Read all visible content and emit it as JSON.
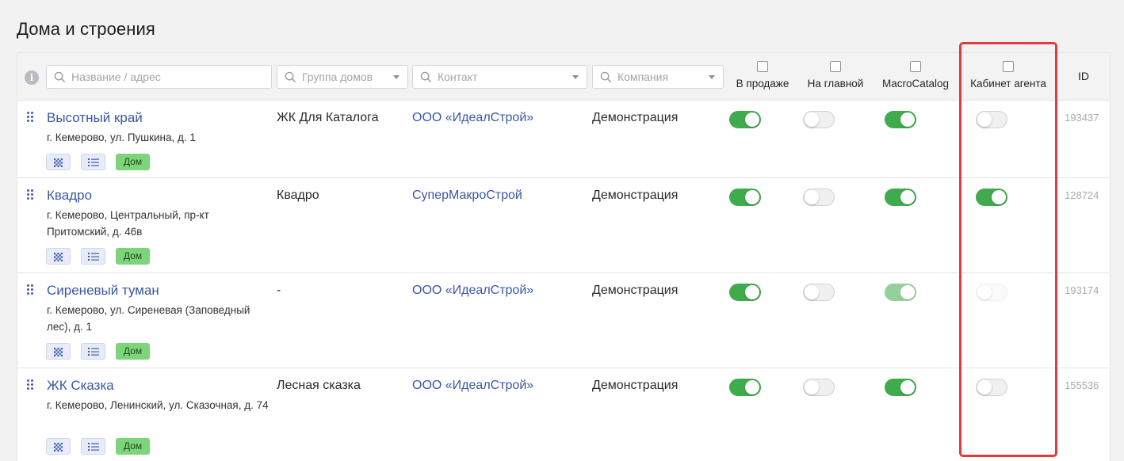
{
  "page": {
    "title": "Дома и строения"
  },
  "filters": {
    "name_placeholder": "Название / адрес",
    "group_placeholder": "Группа домов",
    "contact_placeholder": "Контакт",
    "company_placeholder": "Компания"
  },
  "columns": {
    "on_sale": "В продаже",
    "on_main": "На главной",
    "macro_catalog": "MacroCatalog",
    "agent_cabinet": "Кабинет агента",
    "id": "ID"
  },
  "tag_label": "Дом",
  "colors": {
    "accent": "#3a57a6",
    "toggle_on": "#3fab4c",
    "tag": "#7dd47a",
    "highlight": "#e23b3b"
  },
  "rows": [
    {
      "name": "Высотный край",
      "address": "г. Кемерово, ул. Пушкина, д. 1",
      "group": "ЖК Для Каталога",
      "contact": "ООО «ИдеалСтрой»",
      "company": "Демонстрация",
      "on_sale": true,
      "on_main": false,
      "macro_catalog": true,
      "agent_cabinet": false,
      "id": "193437"
    },
    {
      "name": "Квадро",
      "address": "г. Кемерово, Центральный, пр-кт Притомский, д. 46в",
      "group": "Квадро",
      "contact": "СуперМакроСтрой",
      "company": "Демонстрация",
      "on_sale": true,
      "on_main": false,
      "macro_catalog": true,
      "agent_cabinet": true,
      "id": "128724"
    },
    {
      "name": "Сиреневый туман",
      "address": "г. Кемерово, ул. Сиреневая (Заповедный лес), д. 1",
      "group": "-",
      "contact": "ООО «ИдеалСтрой»",
      "company": "Демонстрация",
      "on_sale": true,
      "on_main": false,
      "macro_catalog": true,
      "agent_cabinet": false,
      "macro_catalog_disabled": true,
      "agent_cabinet_disabled": true,
      "id": "193174"
    },
    {
      "name": "ЖК Сказка",
      "address": "г. Кемерово, Ленинский, ул. Сказочная, д. 74",
      "group": "Лесная сказка",
      "contact": "ООО «ИдеалСтрой»",
      "company": "Демонстрация",
      "on_sale": true,
      "on_main": false,
      "macro_catalog": true,
      "agent_cabinet": false,
      "id": "155536"
    }
  ]
}
